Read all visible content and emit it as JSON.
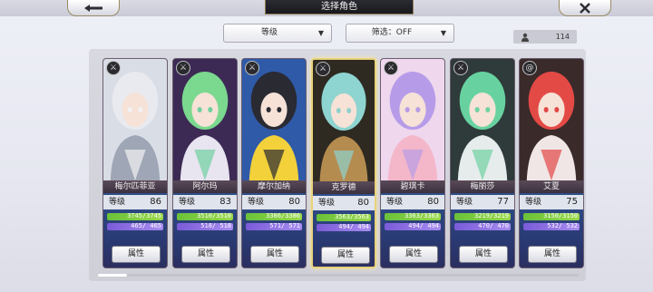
{
  "header": {
    "title": "选择角色",
    "back_icon": "arrow-left-icon",
    "close_icon": "close-icon"
  },
  "filters": {
    "sort_label": "等级",
    "filter_label": "筛选：OFF",
    "count": "114"
  },
  "stat_labels": {
    "level": "等级",
    "attr_button": "属性"
  },
  "characters": [
    {
      "name": "梅尔匹菲亚",
      "level": "86",
      "hp": "3745/3745",
      "sp": "465/ 465",
      "class_icon": "sword-class-icon",
      "palette": [
        "#d9dde6",
        "#f2f2f4",
        "#9fa6b5"
      ],
      "hair": "#e8eaf0"
    },
    {
      "name": "阿尔玛",
      "level": "83",
      "hp": "3510/3510",
      "sp": "518/ 518",
      "class_icon": "sword-class-icon",
      "palette": [
        "#3c2a55",
        "#6fd0a0",
        "#e8e4f0"
      ],
      "hair": "#7bd88f"
    },
    {
      "name": "摩尔加纳",
      "level": "80",
      "hp": "3386/3386",
      "sp": "571/ 571",
      "class_icon": "sword-class-icon",
      "palette": [
        "#2f5aa8",
        "#2a2a33",
        "#f2d13a"
      ],
      "hair": "#2a2a33"
    },
    {
      "name": "克罗德",
      "level": "80",
      "hp": "3563/3563",
      "sp": "494/ 494",
      "class_icon": "sword-class-icon",
      "palette": [
        "#2e2a22",
        "#8fd1cf",
        "#b58c4f"
      ],
      "hair": "#8ed4d0",
      "selected": true
    },
    {
      "name": "碧琪卡",
      "level": "80",
      "hp": "3363/3363",
      "sp": "494/ 494",
      "class_icon": "sword-class-icon",
      "palette": [
        "#efd7ee",
        "#b79be6",
        "#f4b7c9"
      ],
      "hair": "#b69ce8"
    },
    {
      "name": "梅丽莎",
      "level": "77",
      "hp": "3219/3219",
      "sp": "470/ 470",
      "class_icon": "sword-class-icon",
      "palette": [
        "#2f3a3a",
        "#6fd2a3",
        "#e6ecec"
      ],
      "hair": "#67d2a0"
    },
    {
      "name": "艾夏",
      "level": "75",
      "hp": "3150/3150",
      "sp": "532/ 532",
      "class_icon": "spiral-class-icon",
      "palette": [
        "#3a2a2a",
        "#e24646",
        "#f0e6e6"
      ],
      "hair": "#e34a45"
    }
  ]
}
